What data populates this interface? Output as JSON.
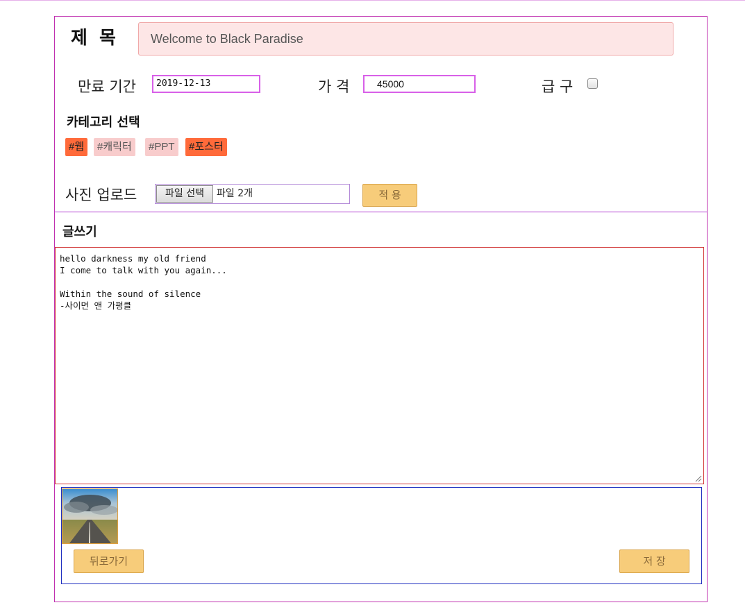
{
  "form": {
    "title_label": "제 목",
    "title_value": "Welcome to Black Paradise",
    "expiry_label": "만료 기간",
    "expiry_value": "2019-12-13",
    "price_label": "가 격",
    "price_value": "45000",
    "urgent_label": "급 구",
    "urgent_checked": false
  },
  "category": {
    "title": "카테고리 선택",
    "tags": [
      {
        "label": "#웹",
        "selected": true
      },
      {
        "label": "#캐릭터",
        "selected": false
      },
      {
        "label": "#PPT",
        "selected": false
      },
      {
        "label": "#포스터",
        "selected": true
      }
    ]
  },
  "upload": {
    "label": "사진 업로드",
    "file_button": "파일 선택",
    "file_status": "파일 2개",
    "apply_button": "적 용"
  },
  "write": {
    "title": "글쓰기",
    "content": "hello darkness my old friend\nI come to talk with you again...\n\nWithin the sound of silence\n-사이먼 앤 가펑클"
  },
  "actions": {
    "back_button": "뒤로가기",
    "save_button": "저 장"
  },
  "colors": {
    "tag_selected": "#ff6a3a",
    "tag_unselected": "#f8cccc",
    "button_orange": "#f7cc7a",
    "title_input_bg": "#fde6e6"
  }
}
